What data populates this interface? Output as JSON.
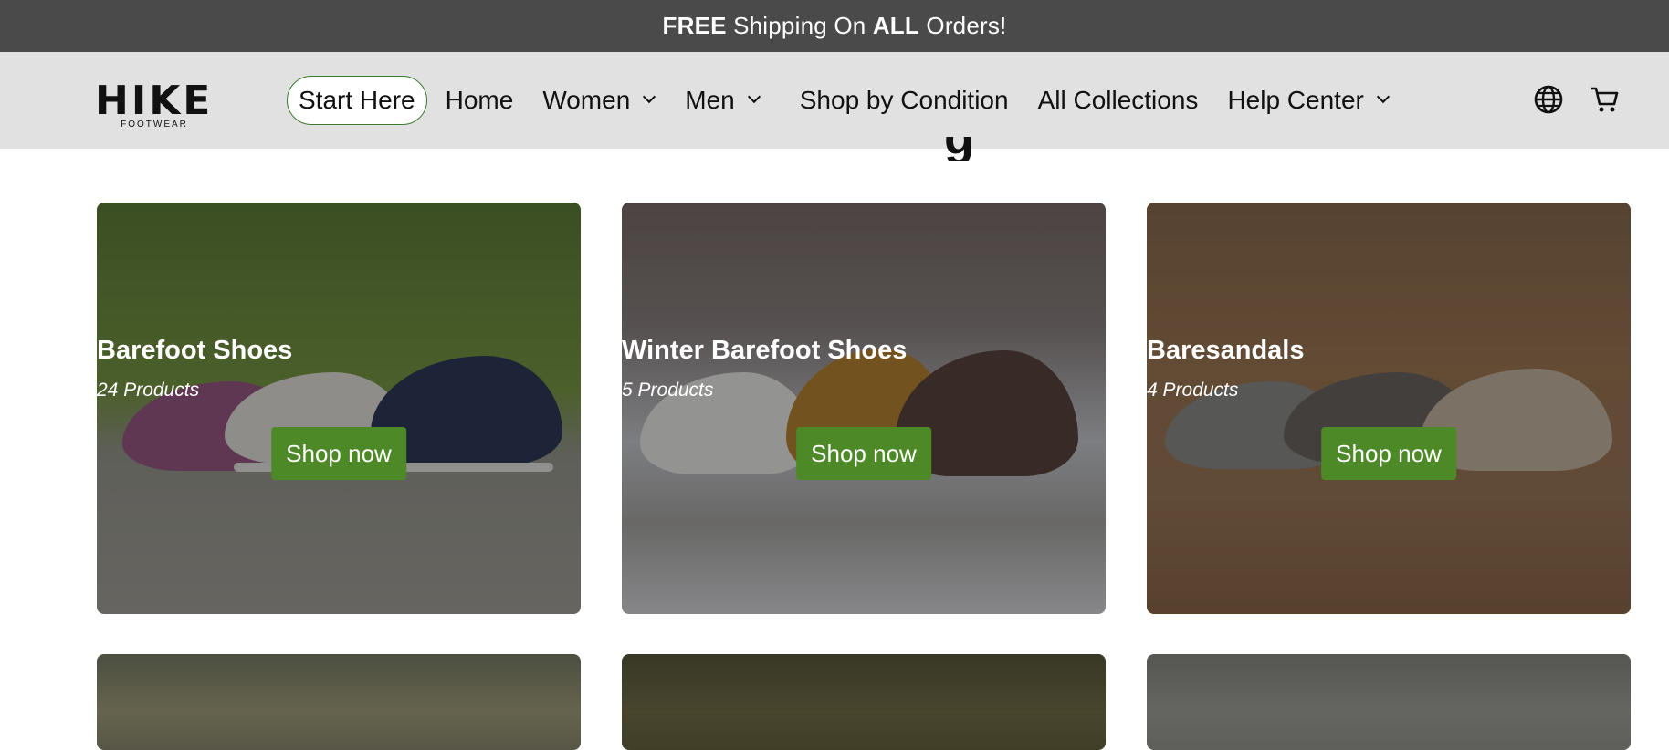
{
  "announcement": {
    "bold1": "FREE",
    "text1": " Shipping On ",
    "bold2": "ALL",
    "text2": " Orders!"
  },
  "logo": {
    "main": "HIKE",
    "sub": "FOOTWEAR"
  },
  "nav": {
    "start_here": "Start Here",
    "home": "Home",
    "women": "Women",
    "men": "Men",
    "shop_by_condition": "Shop by Condition",
    "all_collections": "All Collections",
    "help_center": "Help Center"
  },
  "icons": {
    "language": "globe-icon",
    "cart": "cart-icon",
    "dropdown": "chevron-down-icon"
  },
  "colors": {
    "announcement_bg": "#4a4a4a",
    "header_bg": "#e1e1e1",
    "button_green": "#4d8a27",
    "pill_border": "#3c7a2a"
  },
  "heading_fragment": "g",
  "collections": [
    {
      "title": "Barefoot Shoes",
      "count": "24 Products",
      "button": "Shop now"
    },
    {
      "title": "Winter Barefoot Shoes",
      "count": "5 Products",
      "button": "Shop now"
    },
    {
      "title": "Baresandals",
      "count": "4 Products",
      "button": "Shop now"
    }
  ]
}
